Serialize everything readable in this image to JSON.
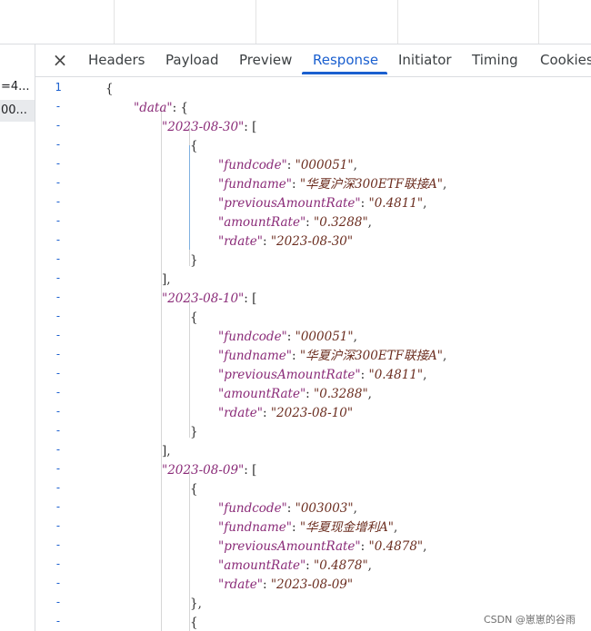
{
  "tabs": [
    {
      "label": "Headers"
    },
    {
      "label": "Payload"
    },
    {
      "label": "Preview"
    },
    {
      "label": "Response"
    },
    {
      "label": "Initiator"
    },
    {
      "label": "Timing"
    },
    {
      "label": "Cookies"
    }
  ],
  "active_tab": "Response",
  "close_icon": "×",
  "left_rows": [
    "=4...",
    "00..."
  ],
  "gutter": [
    "1",
    "-",
    "-",
    "-",
    "-",
    "-",
    "-",
    "-",
    "-",
    "-",
    "-",
    "-",
    "-",
    "-",
    "-",
    "-",
    "-",
    "-",
    "-",
    "-",
    "-",
    "-",
    "-",
    "-",
    "-",
    "-",
    "-",
    "-",
    "-",
    "-"
  ],
  "response": {
    "open_brace": "{",
    "data_key": "\"data\"",
    "groups": [
      {
        "date_key": "\"2023-08-30\"",
        "fundcode": "\"000051\"",
        "fundname": "\"华夏沪深300ETF联接A\"",
        "previousAmountRate": "\"0.4811\"",
        "amountRate": "\"0.3288\"",
        "rdate": "\"2023-08-30\""
      },
      {
        "date_key": "\"2023-08-10\"",
        "fundcode": "\"000051\"",
        "fundname": "\"华夏沪深300ETF联接A\"",
        "previousAmountRate": "\"0.4811\"",
        "amountRate": "\"0.3288\"",
        "rdate": "\"2023-08-10\""
      },
      {
        "date_key": "\"2023-08-09\"",
        "fundcode": "\"003003\"",
        "fundname": "\"华夏现金增利A\"",
        "previousAmountRate": "\"0.4878\"",
        "amountRate": "\"0.4878\"",
        "rdate": "\"2023-08-09\""
      }
    ],
    "keys": {
      "fundcode": "\"fundcode\"",
      "fundname": "\"fundname\"",
      "previousAmountRate": "\"previousAmountRate\"",
      "amountRate": "\"amountRate\"",
      "rdate": "\"rdate\""
    }
  },
  "watermark": "CSDN @崽崽的谷雨"
}
